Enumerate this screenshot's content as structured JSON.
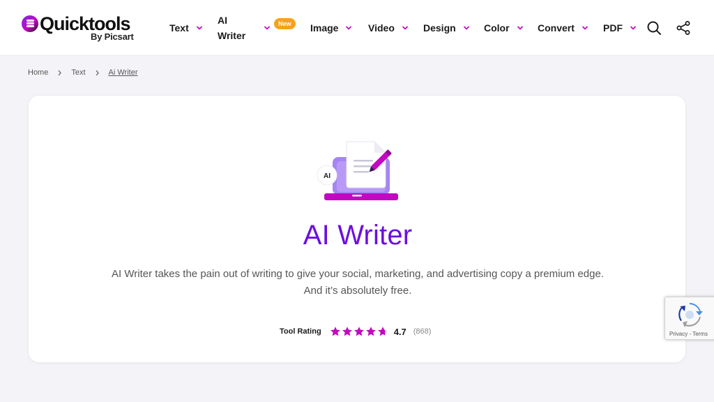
{
  "brand": {
    "name": "Quicktools",
    "sub": "By Picsart"
  },
  "nav": {
    "items": [
      {
        "label": "Text"
      },
      {
        "label_line1": "AI",
        "label_line2": "Writer",
        "badge": "New"
      },
      {
        "label": "Image"
      },
      {
        "label": "Video"
      },
      {
        "label": "Design"
      },
      {
        "label": "Color"
      },
      {
        "label": "Convert"
      },
      {
        "label": "PDF"
      }
    ],
    "search_icon": "search-icon",
    "share_icon": "share-icon"
  },
  "breadcrumb": {
    "items": [
      "Home",
      "Text",
      "Ai Writer"
    ]
  },
  "hero": {
    "illustration_badge": "AI",
    "title": "AI Writer",
    "description_line1": "AI Writer takes the pain out of writing to give your social, marketing, and advertising copy a premium edge.",
    "description_line2": "And it’s absolutely free."
  },
  "rating": {
    "label": "Tool Rating",
    "value": "4.7",
    "count": "(868)",
    "stars_filled": 4.7,
    "stars_max": 5
  },
  "recaptcha": {
    "links": "Privacy - Terms"
  },
  "colors": {
    "accent": "#6b0fe0",
    "magenta": "#c209c1",
    "badge": "#f9a11b",
    "background": "#f4f4f8"
  }
}
